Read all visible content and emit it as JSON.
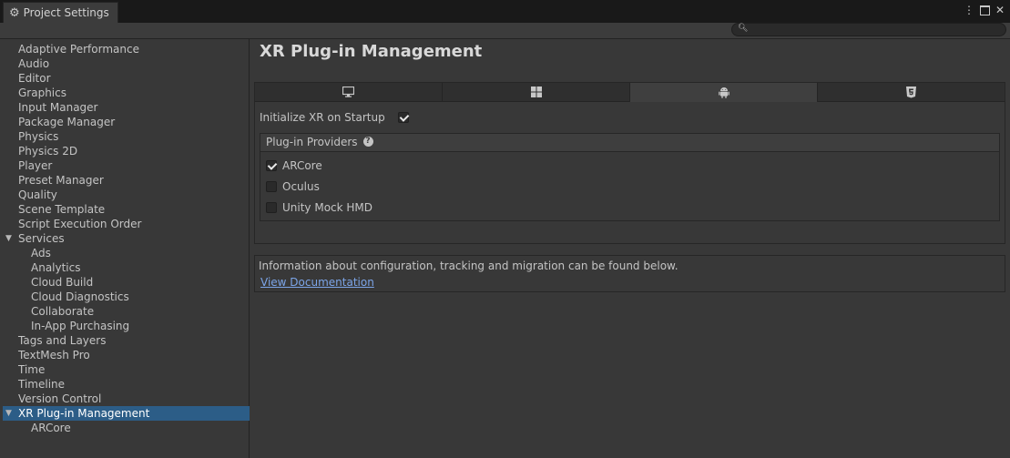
{
  "window": {
    "tab_title": "Project Settings",
    "tab_icon": "gear-icon",
    "controls": [
      "more-menu-icon",
      "maximize-icon",
      "close-icon"
    ]
  },
  "search": {
    "placeholder": "",
    "value": ""
  },
  "sidebar": {
    "items": [
      {
        "label": "Adaptive Performance",
        "indent": 0
      },
      {
        "label": "Audio",
        "indent": 0
      },
      {
        "label": "Editor",
        "indent": 0
      },
      {
        "label": "Graphics",
        "indent": 0
      },
      {
        "label": "Input Manager",
        "indent": 0
      },
      {
        "label": "Package Manager",
        "indent": 0
      },
      {
        "label": "Physics",
        "indent": 0
      },
      {
        "label": "Physics 2D",
        "indent": 0
      },
      {
        "label": "Player",
        "indent": 0
      },
      {
        "label": "Preset Manager",
        "indent": 0
      },
      {
        "label": "Quality",
        "indent": 0
      },
      {
        "label": "Scene Template",
        "indent": 0
      },
      {
        "label": "Script Execution Order",
        "indent": 0
      },
      {
        "label": "Services",
        "indent": 0,
        "expanded": true
      },
      {
        "label": "Ads",
        "indent": 1
      },
      {
        "label": "Analytics",
        "indent": 1
      },
      {
        "label": "Cloud Build",
        "indent": 1
      },
      {
        "label": "Cloud Diagnostics",
        "indent": 1
      },
      {
        "label": "Collaborate",
        "indent": 1
      },
      {
        "label": "In-App Purchasing",
        "indent": 1
      },
      {
        "label": "Tags and Layers",
        "indent": 0
      },
      {
        "label": "TextMesh Pro",
        "indent": 0
      },
      {
        "label": "Time",
        "indent": 0
      },
      {
        "label": "Timeline",
        "indent": 0
      },
      {
        "label": "Version Control",
        "indent": 0
      },
      {
        "label": "XR Plug-in Management",
        "indent": 0,
        "expanded": true,
        "selected": true
      },
      {
        "label": "ARCore",
        "indent": 1
      }
    ]
  },
  "main": {
    "title": "XR Plug-in Management",
    "platform_tabs": [
      {
        "icon": "desktop-monitor-icon",
        "active": false
      },
      {
        "icon": "windows-logo-icon",
        "active": false
      },
      {
        "icon": "android-icon",
        "active": true
      },
      {
        "icon": "html5-icon",
        "active": false
      }
    ],
    "init_label": "Initialize XR on Startup",
    "init_checked": true,
    "providers_header": "Plug-in Providers",
    "providers": [
      {
        "label": "ARCore",
        "checked": true
      },
      {
        "label": "Oculus",
        "checked": false
      },
      {
        "label": "Unity Mock HMD",
        "checked": false
      }
    ],
    "info_text": "Information about configuration, tracking and migration can be found below.",
    "info_link": "View Documentation"
  },
  "colors": {
    "background": "#383838",
    "titlebar": "#191919",
    "selected": "#2c5d87",
    "link": "#7ca5e8"
  }
}
